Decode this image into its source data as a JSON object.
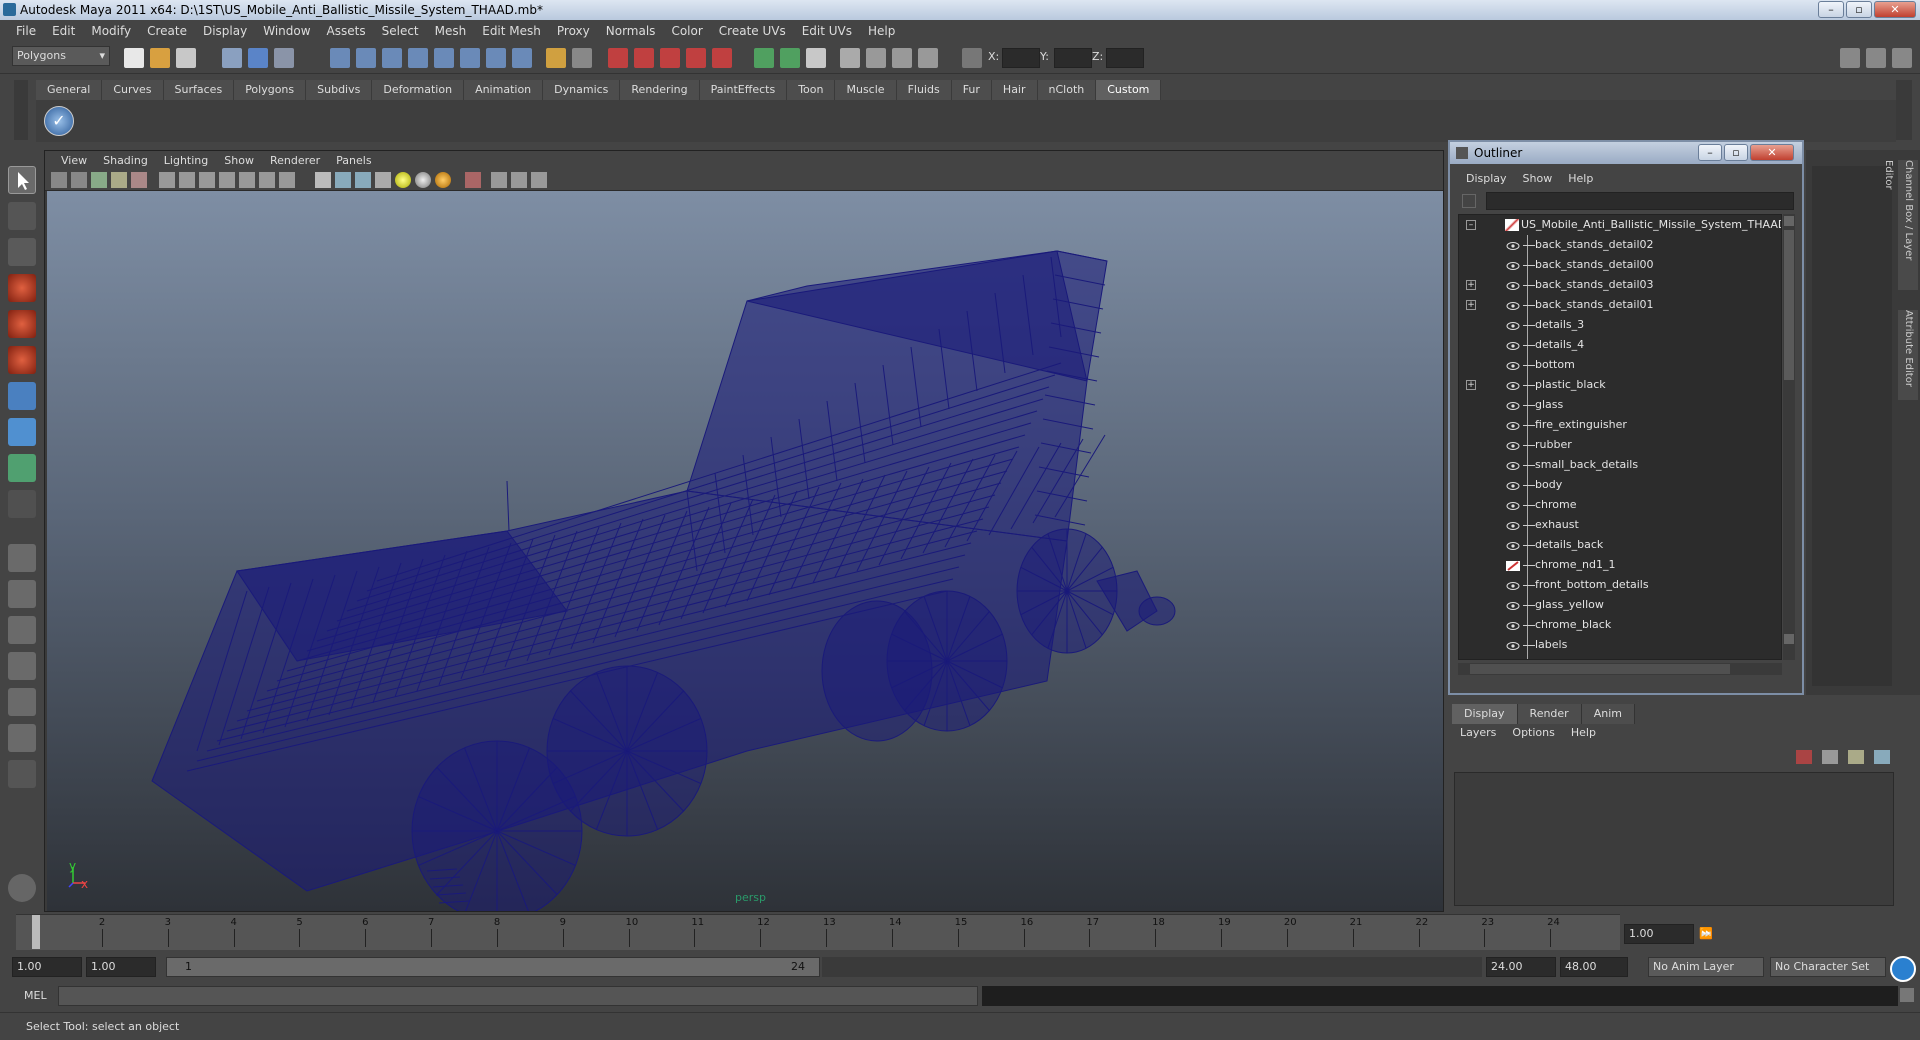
{
  "window": {
    "title": "Autodesk Maya 2011 x64: D:\\1ST\\US_Mobile_Anti_Ballistic_Missile_System_THAAD.mb*",
    "controls": [
      "minimize-icon",
      "maximize-icon",
      "close-icon"
    ]
  },
  "menubar": [
    "File",
    "Edit",
    "Modify",
    "Create",
    "Display",
    "Window",
    "Assets",
    "Select",
    "Mesh",
    "Edit Mesh",
    "Proxy",
    "Normals",
    "Color",
    "Create UVs",
    "Edit UVs",
    "Help"
  ],
  "statusline": {
    "mode": "Polygons",
    "x_label": "X:",
    "y_label": "Y:",
    "z_label": "Z:"
  },
  "shelf_tabs": [
    "General",
    "Curves",
    "Surfaces",
    "Polygons",
    "Subdivs",
    "Deformation",
    "Animation",
    "Dynamics",
    "Rendering",
    "PaintEffects",
    "Toon",
    "Muscle",
    "Fluids",
    "Fur",
    "Hair",
    "nCloth",
    "Custom"
  ],
  "shelf_active": "Custom",
  "panel_menu": [
    "View",
    "Shading",
    "Lighting",
    "Show",
    "Renderer",
    "Panels"
  ],
  "viewport": {
    "camera_label": "persp",
    "axis_x": "x",
    "axis_y": "y",
    "wire_color": "#1a1a7a"
  },
  "outliner": {
    "title": "Outliner",
    "menu": [
      "Display",
      "Show",
      "Help"
    ],
    "root": "US_Mobile_Anti_Ballistic_Missile_System_THAAD",
    "items": [
      {
        "label": "back_stands_detail02",
        "expandable": false
      },
      {
        "label": "back_stands_detail00",
        "expandable": false
      },
      {
        "label": "back_stands_detail03",
        "expandable": true
      },
      {
        "label": "back_stands_detail01",
        "expandable": true
      },
      {
        "label": "details_3",
        "expandable": false
      },
      {
        "label": "details_4",
        "expandable": false
      },
      {
        "label": "bottom",
        "expandable": false
      },
      {
        "label": "plastic_black",
        "expandable": true
      },
      {
        "label": "glass",
        "expandable": false
      },
      {
        "label": "fire_extinguisher",
        "expandable": false
      },
      {
        "label": "rubber",
        "expandable": false
      },
      {
        "label": "small_back_details",
        "expandable": false
      },
      {
        "label": "body",
        "expandable": false
      },
      {
        "label": "chrome",
        "expandable": false
      },
      {
        "label": "exhaust",
        "expandable": false
      },
      {
        "label": "details_back",
        "expandable": false
      },
      {
        "label": "chrome_nd1_1",
        "expandable": false
      },
      {
        "label": "front_bottom_details",
        "expandable": false
      },
      {
        "label": "glass_yellow",
        "expandable": false
      },
      {
        "label": "chrome_black",
        "expandable": false
      },
      {
        "label": "labels",
        "expandable": false
      }
    ]
  },
  "layer_editor": {
    "tabs": [
      "Display",
      "Render",
      "Anim"
    ],
    "active_tab": "Display",
    "menu": [
      "Layers",
      "Options",
      "Help"
    ]
  },
  "right_dock_labels": [
    "Channel Box / Layer Editor",
    "Attribute Editor"
  ],
  "timeline": {
    "ticks": [
      "1",
      "2",
      "3",
      "4",
      "5",
      "6",
      "7",
      "8",
      "9",
      "10",
      "11",
      "12",
      "13",
      "14",
      "15",
      "16",
      "17",
      "18",
      "19",
      "20",
      "21",
      "22",
      "23",
      "24"
    ],
    "current_frame": "1.00"
  },
  "range": {
    "start": "1.00",
    "playback_start": "1.00",
    "slider_start": "1",
    "slider_end": "24",
    "playback_end": "24.00",
    "end": "48.00",
    "anim_layer": "No Anim Layer",
    "character_set": "No Character Set"
  },
  "command": {
    "label": "MEL"
  },
  "help_line": "Select Tool: select an object"
}
